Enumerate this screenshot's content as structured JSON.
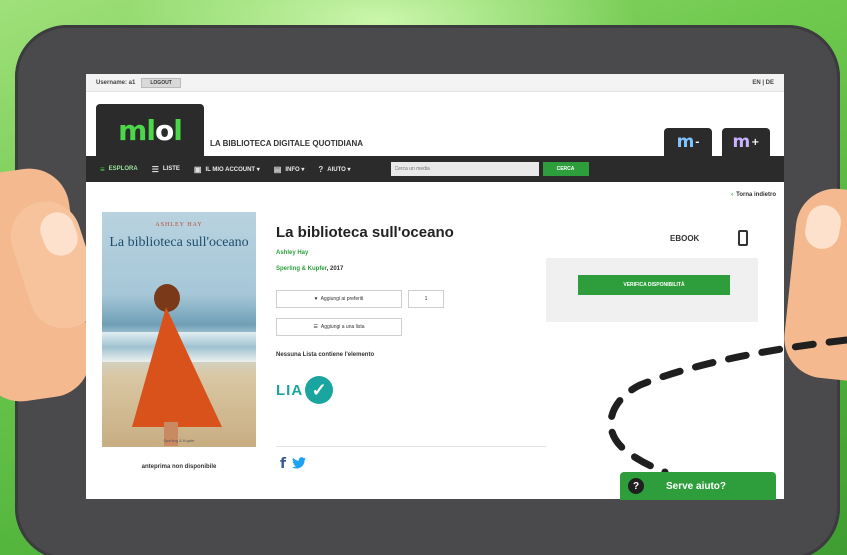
{
  "topbar": {
    "username_label": "Username: a1",
    "logout_label": "LOGOUT",
    "lang": "EN | DE"
  },
  "header": {
    "logo_m": "ml",
    "logo_o": "o",
    "logo_l": "l",
    "tagline": "LA BIBLIOTECA DIGITALE QUOTIDIANA",
    "tab_m_minus": "m",
    "tab_m_plus": "m",
    "tab_minus_sign": "-",
    "tab_plus_sign": "+"
  },
  "nav": {
    "items": [
      {
        "label": "ESPLORA",
        "icon": "≡"
      },
      {
        "label": "LISTE",
        "icon": "☰"
      },
      {
        "label": "IL MIO ACCOUNT ▾",
        "icon": "▣"
      },
      {
        "label": "INFO ▾",
        "icon": "▤"
      },
      {
        "label": "AIUTO ▾",
        "icon": "?"
      }
    ],
    "search_placeholder": "Cerca un media",
    "search_button": "CERCA"
  },
  "back_link": "Torna indietro",
  "cover": {
    "author": "ASHLEY HAY",
    "title": "La biblioteca sull'oceano",
    "publisher": "Sperling & Kupfer"
  },
  "preview_note": "anteprima non disponibile",
  "book": {
    "title": "La biblioteca sull'oceano",
    "author": "Ashley Hay",
    "publisher": "Sperling & Kupfer",
    "year": ", 2017"
  },
  "actions": {
    "favorite_label": "Aggiungi ai preferiti",
    "favorite_count": "1",
    "list_label": "Aggiungi a una lista",
    "no_list_text": "Nessuna Lista contiene l'elemento"
  },
  "lia": {
    "label": "LIA",
    "check": "✓"
  },
  "social": {
    "facebook": "f",
    "twitter": "🐦"
  },
  "format": {
    "label": "EBOOK"
  },
  "availability": {
    "button_label": "VERIFICA DISPONIBILITÀ"
  },
  "help": {
    "icon": "?",
    "label": "Serve aiuto?"
  },
  "colors": {
    "accent_green": "#2e9e3c",
    "logo_green": "#4cd64a",
    "lia_teal": "#1aa5a0",
    "navbar": "#2b2b2b"
  }
}
